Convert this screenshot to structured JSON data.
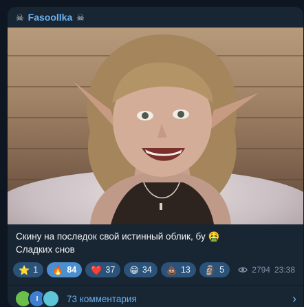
{
  "channel": {
    "name": "Fasoollka",
    "decor_left": "☠",
    "decor_right": "☠"
  },
  "post": {
    "caption_line1": "Скину на последок свой истинный облик, бу 🤮",
    "caption_line2": "Сладких снов"
  },
  "reactions": [
    {
      "emoji": "⭐",
      "count": "1",
      "active": false
    },
    {
      "emoji": "🔥",
      "count": "84",
      "active": true
    },
    {
      "emoji": "❤️",
      "count": "37",
      "active": false
    },
    {
      "emoji": "😁",
      "count": "34",
      "active": false
    },
    {
      "emoji": "💩",
      "count": "13",
      "active": false
    },
    {
      "emoji": "🗿",
      "count": "5",
      "active": false
    }
  ],
  "meta": {
    "views": "2794",
    "time": "23:38"
  },
  "comments": {
    "label": "73 комментария",
    "avatars": [
      {
        "color": "#6abf4b",
        "letter": ""
      },
      {
        "color": "#3f7fd1",
        "letter": "I"
      },
      {
        "color": "#5ec4d8",
        "letter": ""
      }
    ]
  },
  "colors": {
    "background": "#0e1621",
    "bubble": "#182533",
    "accent": "#6ab3f3",
    "reaction_bg": "#2b5278",
    "reaction_active": "#4b8fd0"
  }
}
